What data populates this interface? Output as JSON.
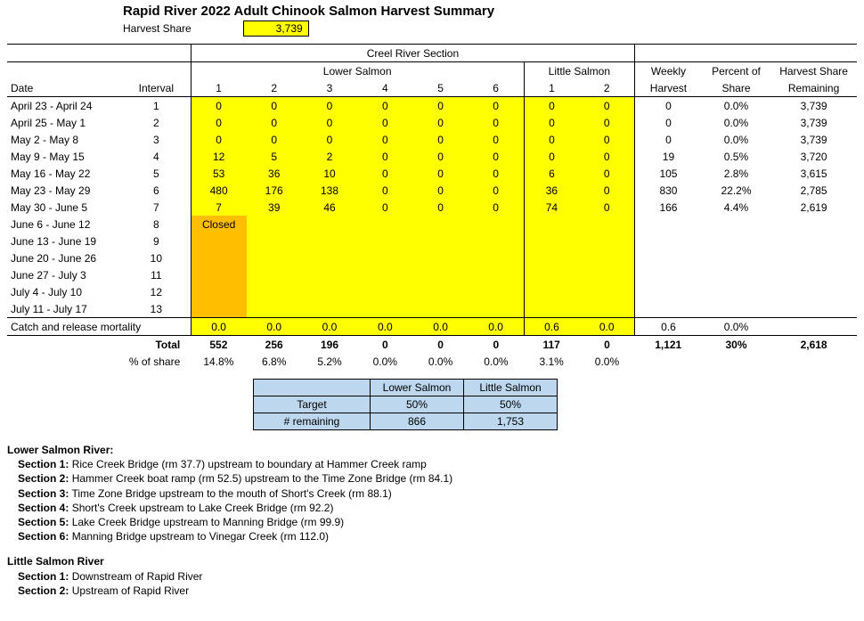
{
  "title": "Rapid River 2022 Adult Chinook Salmon Harvest Summary",
  "harvest_share_label": "Harvest Share",
  "harvest_share_value": "3,739",
  "headers": {
    "creel": "Creel River Section",
    "lower_salmon": "Lower Salmon",
    "little_salmon": "Little Salmon",
    "date": "Date",
    "interval": "Interval",
    "weekly_harvest": "Weekly Harvest",
    "percent_of_share": "Percent of Share",
    "harvest_remaining": "Harvest Share Remaining",
    "sections_lower": [
      "1",
      "2",
      "3",
      "4",
      "5",
      "6"
    ],
    "sections_little": [
      "1",
      "2"
    ]
  },
  "rows": [
    {
      "date": "April 23 - April 24",
      "interval": "1",
      "ls": [
        "0",
        "0",
        "0",
        "0",
        "0",
        "0"
      ],
      "lt": [
        "0",
        "0"
      ],
      "w": "0",
      "p": "0.0%",
      "r": "3,739"
    },
    {
      "date": "April 25 - May 1",
      "interval": "2",
      "ls": [
        "0",
        "0",
        "0",
        "0",
        "0",
        "0"
      ],
      "lt": [
        "0",
        "0"
      ],
      "w": "0",
      "p": "0.0%",
      "r": "3,739"
    },
    {
      "date": "May 2 - May 8",
      "interval": "3",
      "ls": [
        "0",
        "0",
        "0",
        "0",
        "0",
        "0"
      ],
      "lt": [
        "0",
        "0"
      ],
      "w": "0",
      "p": "0.0%",
      "r": "3,739"
    },
    {
      "date": "May 9 - May 15",
      "interval": "4",
      "ls": [
        "12",
        "5",
        "2",
        "0",
        "0",
        "0"
      ],
      "lt": [
        "0",
        "0"
      ],
      "w": "19",
      "p": "0.5%",
      "r": "3,720"
    },
    {
      "date": "May 16 - May 22",
      "interval": "5",
      "ls": [
        "53",
        "36",
        "10",
        "0",
        "0",
        "0"
      ],
      "lt": [
        "6",
        "0"
      ],
      "w": "105",
      "p": "2.8%",
      "r": "3,615"
    },
    {
      "date": "May 23 - May 29",
      "interval": "6",
      "ls": [
        "480",
        "176",
        "138",
        "0",
        "0",
        "0"
      ],
      "lt": [
        "36",
        "0"
      ],
      "w": "830",
      "p": "22.2%",
      "r": "2,785"
    },
    {
      "date": "May 30 - June 5",
      "interval": "7",
      "ls": [
        "7",
        "39",
        "46",
        "0",
        "0",
        "0"
      ],
      "lt": [
        "74",
        "0"
      ],
      "w": "166",
      "p": "4.4%",
      "r": "2,619"
    }
  ],
  "closed_rows": [
    {
      "date": "June 6 - June 12",
      "interval": "8",
      "closed": "Closed"
    },
    {
      "date": "June 13 - June 19",
      "interval": "9",
      "closed": ""
    },
    {
      "date": "June 20 - June 26",
      "interval": "10",
      "closed": ""
    },
    {
      "date": "June 27 - July 3",
      "interval": "11",
      "closed": ""
    },
    {
      "date": "July 4 - July 10",
      "interval": "12",
      "closed": ""
    },
    {
      "date": "July 11 - July 17",
      "interval": "13",
      "closed": ""
    }
  ],
  "crm": {
    "label": "Catch and release mortality",
    "ls": [
      "0.0",
      "0.0",
      "0.0",
      "0.0",
      "0.0",
      "0.0"
    ],
    "lt": [
      "0.6",
      "0.0"
    ],
    "w": "0.6",
    "p": "0.0%",
    "r": ""
  },
  "totals": {
    "label": "Total",
    "ls": [
      "552",
      "256",
      "196",
      "0",
      "0",
      "0"
    ],
    "lt": [
      "117",
      "0"
    ],
    "w": "1,121",
    "p": "30%",
    "r": "2,618"
  },
  "pct_of_share": {
    "label": "% of share",
    "ls": [
      "14.8%",
      "6.8%",
      "5.2%",
      "0.0%",
      "0.0%",
      "0.0%"
    ],
    "lt": [
      "3.1%",
      "0.0%"
    ]
  },
  "mini": {
    "col1": "Lower Salmon",
    "col2": "Little Salmon",
    "row1_label": "Target",
    "row1_v1": "50%",
    "row1_v2": "50%",
    "row2_label": "# remaining",
    "row2_v1": "866",
    "row2_v2": "1,753"
  },
  "sections_text": {
    "lower_header": "Lower Salmon River:",
    "lower": [
      [
        "Section 1:",
        "Rice Creek Bridge (rm 37.7) upstream to boundary at Hammer Creek ramp"
      ],
      [
        "Section 2:",
        "Hammer Creek boat ramp (rm 52.5) upstream to the Time Zone Bridge (rm 84.1)"
      ],
      [
        "Section 3:",
        "Time Zone Bridge upstream to the mouth of Short's Creek (rm 88.1)"
      ],
      [
        "Section 4:",
        "Short's Creek upstream to Lake Creek Bridge (rm 92.2)"
      ],
      [
        "Section 5:",
        "Lake Creek Bridge upstream to Manning Bridge (rm 99.9)"
      ],
      [
        "Section 6:",
        "Manning Bridge upstream to Vinegar Creek (rm 112.0)"
      ]
    ],
    "little_header": "Little Salmon River",
    "little": [
      [
        "Section 1:",
        "Downstream of Rapid River"
      ],
      [
        "Section 2:",
        "Upstream of Rapid River"
      ]
    ]
  },
  "chart_data": {
    "type": "table",
    "title": "Rapid River 2022 Adult Chinook Salmon Harvest Summary",
    "harvest_share": 3739,
    "columns": [
      "Date",
      "Interval",
      "LS1",
      "LS2",
      "LS3",
      "LS4",
      "LS5",
      "LS6",
      "Little1",
      "Little2",
      "Weekly Harvest",
      "Percent of Share",
      "Harvest Share Remaining"
    ],
    "rows": [
      [
        "April 23 - April 24",
        1,
        0,
        0,
        0,
        0,
        0,
        0,
        0,
        0,
        0,
        0.0,
        3739
      ],
      [
        "April 25 - May 1",
        2,
        0,
        0,
        0,
        0,
        0,
        0,
        0,
        0,
        0,
        0.0,
        3739
      ],
      [
        "May 2 - May 8",
        3,
        0,
        0,
        0,
        0,
        0,
        0,
        0,
        0,
        0,
        0.0,
        3739
      ],
      [
        "May 9 - May 15",
        4,
        12,
        5,
        2,
        0,
        0,
        0,
        0,
        0,
        19,
        0.5,
        3720
      ],
      [
        "May 16 - May 22",
        5,
        53,
        36,
        10,
        0,
        0,
        0,
        6,
        0,
        105,
        2.8,
        3615
      ],
      [
        "May 23 - May 29",
        6,
        480,
        176,
        138,
        0,
        0,
        0,
        36,
        0,
        830,
        22.2,
        2785
      ],
      [
        "May 30 - June 5",
        7,
        7,
        39,
        46,
        0,
        0,
        0,
        74,
        0,
        166,
        4.4,
        2619
      ]
    ],
    "catch_release_mortality": {
      "LS": [
        0.0,
        0.0,
        0.0,
        0.0,
        0.0,
        0.0
      ],
      "Little": [
        0.6,
        0.0
      ],
      "Weekly": 0.6,
      "Percent": 0.0
    },
    "totals": {
      "LS": [
        552,
        256,
        196,
        0,
        0,
        0
      ],
      "Little": [
        117,
        0
      ],
      "Weekly": 1121,
      "Percent": 30,
      "Remaining": 2618
    },
    "pct_of_share": {
      "LS": [
        14.8,
        6.8,
        5.2,
        0.0,
        0.0,
        0.0
      ],
      "Little": [
        3.1,
        0.0
      ]
    },
    "targets": {
      "LowerSalmon": {
        "target_pct": 50,
        "remaining": 866
      },
      "LittleSalmon": {
        "target_pct": 50,
        "remaining": 1753
      }
    }
  }
}
